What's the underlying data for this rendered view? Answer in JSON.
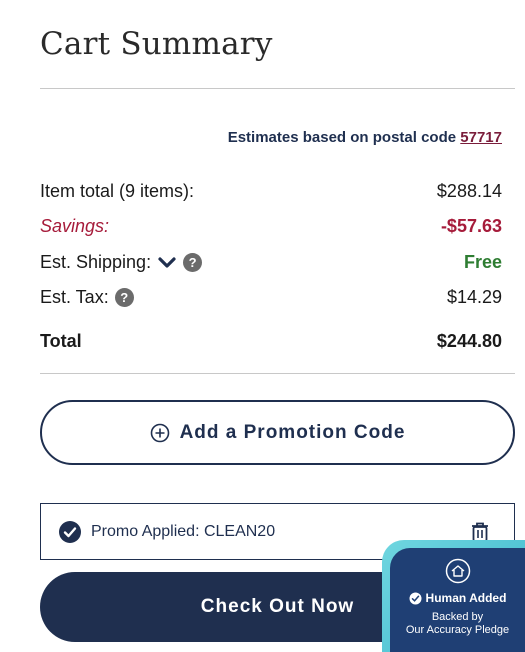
{
  "summary": {
    "title": "Cart Summary",
    "postal_prefix": "Estimates based on postal code",
    "postal_code": "57717",
    "rows": {
      "item_total_label": "Item total (9 items):",
      "item_total_value": "$288.14",
      "savings_label": "Savings:",
      "savings_value": "-$57.63",
      "shipping_label": "Est. Shipping:",
      "shipping_value": "Free",
      "tax_label": "Est. Tax:",
      "tax_value": "$14.29",
      "total_label": "Total",
      "total_value": "$244.80"
    }
  },
  "promo": {
    "add_label": "Add a Promotion Code",
    "applied_text": "Promo Applied: CLEAN20"
  },
  "checkout": {
    "label": "Check Out Now"
  },
  "pledge": {
    "heading": "Human Added",
    "line1": "Backed by",
    "line2": "Our Accuracy Pledge"
  },
  "icons": {
    "chevron": "chevron-down-icon",
    "help": "help-circle-icon",
    "plus": "plus-circle-icon",
    "check": "check-circle-icon",
    "trash": "trash-icon",
    "logo": "house-badge-icon"
  },
  "colors": {
    "navy": "#1f2f4f",
    "savings": "#a61b3a",
    "free": "#2e7d32",
    "pledge_bg": "#1f3f74",
    "pledge_border": "#3fb8cc"
  }
}
